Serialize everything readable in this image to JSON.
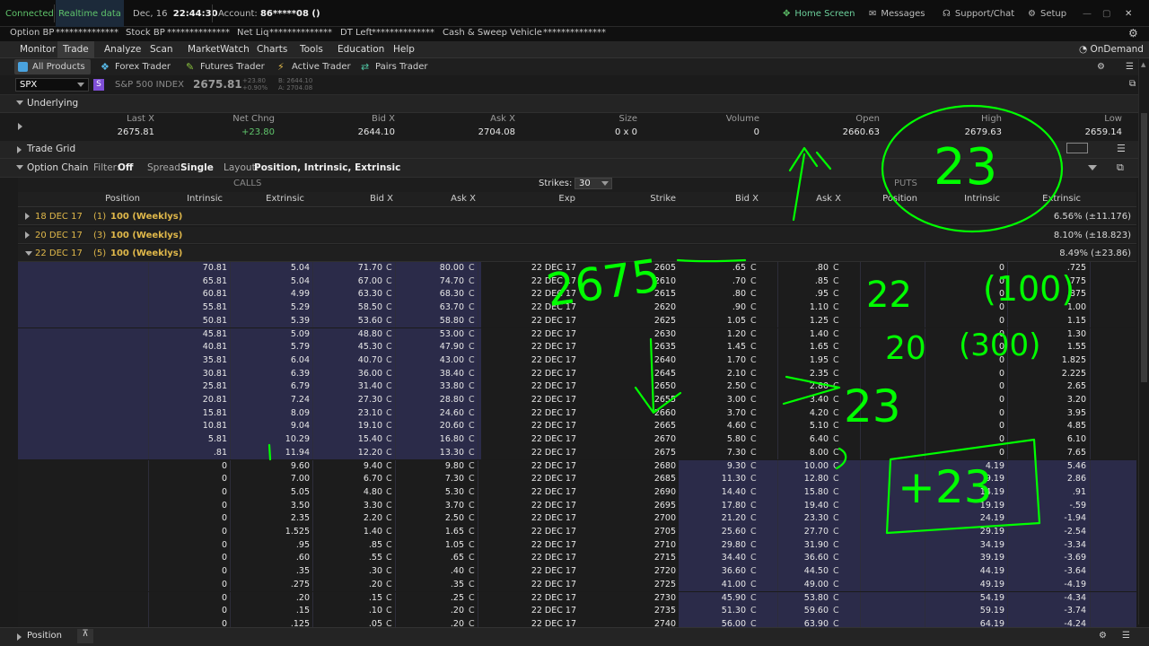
{
  "status": {
    "connected": "Connected",
    "realtime": "Realtime data",
    "date": "Dec, 16",
    "time": "22:44:30",
    "account_label": "Account:",
    "account_value": "86*****08 ()",
    "home_screen": "Home Screen",
    "messages": "Messages",
    "support": "Support/Chat",
    "setup": "Setup"
  },
  "account": {
    "option_bp": "Option BP",
    "option_bp_val": "**************",
    "stock_bp": "Stock BP",
    "stock_bp_val": "**************",
    "net_liq": "Net Liq",
    "net_liq_val": "**************",
    "dt_left": "DT Left",
    "dt_left_val": "**************",
    "cash_sweep": "Cash & Sweep Vehicle",
    "cash_sweep_val": "**************"
  },
  "menu": [
    "Monitor",
    "Trade",
    "Analyze",
    "Scan",
    "MarketWatch",
    "Charts",
    "Tools",
    "Education",
    "Help"
  ],
  "ondemand": "OnDemand",
  "subtabs": [
    "All Products",
    "Forex Trader",
    "Futures Trader",
    "Active Trader",
    "Pairs Trader"
  ],
  "symbol": {
    "ticker": "SPX",
    "badge": "S",
    "name": "S&P 500 INDEX",
    "price": "2675.81",
    "chg": "+23.80",
    "chg_pct": "+0.90%",
    "bid": "B: 2644.10",
    "ask": "A: 2704.08"
  },
  "underlying": {
    "title": "Underlying",
    "headers": [
      "Last X",
      "Net Chng",
      "Bid X",
      "Ask X",
      "Size",
      "Volume",
      "Open",
      "High",
      "Low"
    ],
    "values": [
      "2675.81",
      "+23.80",
      "2644.10",
      "2704.08",
      "0 x 0",
      "0",
      "2660.63",
      "2679.63",
      "2659.14"
    ]
  },
  "trade_grid": "Trade Grid",
  "option_chain": {
    "title": "Option Chain",
    "filter_label": "Filter:",
    "filter_val": "Off",
    "spread_label": "Spread:",
    "spread_val": "Single",
    "layout_label": "Layout:",
    "layout_val": "Position, Intrinsic, Extrinsic",
    "calls": "CALLS",
    "puts": "PUTS",
    "strikes_label": "Strikes:",
    "strikes_val": "30",
    "col_headers": {
      "position": "Position",
      "intrinsic": "Intrinsic",
      "extrinsic": "Extrinsic",
      "bid": "Bid X",
      "ask": "Ask X",
      "exp": "Exp",
      "strike": "Strike",
      "pbid": "Bid X",
      "pask": "Ask X",
      "pposition": "Position",
      "pintrinsic": "Intrinsic",
      "pextrinsic": "Extrinsic"
    }
  },
  "expirations": [
    {
      "date": "18 DEC 17",
      "days": "(1)",
      "mult": "100 (Weeklys)",
      "iv": "6.56% (±11.176)"
    },
    {
      "date": "20 DEC 17",
      "days": "(3)",
      "mult": "100 (Weeklys)",
      "iv": "8.10% (±18.823)"
    },
    {
      "date": "22 DEC 17",
      "days": "(5)",
      "mult": "100 (Weeklys)",
      "iv": "8.49% (±23.86)"
    }
  ],
  "chain_rows": [
    {
      "ci": "70.81",
      "ce": "5.04",
      "cb": "71.70",
      "ca": "80.00",
      "exp": "22 DEC 17",
      "k": "2605",
      "pb": ".65",
      "pa": ".80",
      "pi": "0",
      "pe": ".725",
      "itm": true
    },
    {
      "ci": "65.81",
      "ce": "5.04",
      "cb": "67.00",
      "ca": "74.70",
      "exp": "22 DEC 17",
      "k": "2610",
      "pb": ".70",
      "pa": ".85",
      "pi": "0",
      "pe": ".775",
      "itm": true
    },
    {
      "ci": "60.81",
      "ce": "4.99",
      "cb": "63.30",
      "ca": "68.30",
      "exp": "22 DEC 17",
      "k": "2615",
      "pb": ".80",
      "pa": ".95",
      "pi": "0",
      "pe": ".875",
      "itm": true
    },
    {
      "ci": "55.81",
      "ce": "5.29",
      "cb": "58.50",
      "ca": "63.70",
      "exp": "22 DEC 17",
      "k": "2620",
      "pb": ".90",
      "pa": "1.10",
      "pi": "0",
      "pe": "1.00",
      "itm": true
    },
    {
      "ci": "50.81",
      "ce": "5.39",
      "cb": "53.60",
      "ca": "58.80",
      "exp": "22 DEC 17",
      "k": "2625",
      "pb": "1.05",
      "pa": "1.25",
      "pi": "0",
      "pe": "1.15",
      "itm": true
    },
    {
      "ci": "45.81",
      "ce": "5.09",
      "cb": "48.80",
      "ca": "53.00",
      "exp": "22 DEC 17",
      "k": "2630",
      "pb": "1.20",
      "pa": "1.40",
      "pi": "0",
      "pe": "1.30",
      "itm": true
    },
    {
      "ci": "40.81",
      "ce": "5.79",
      "cb": "45.30",
      "ca": "47.90",
      "exp": "22 DEC 17",
      "k": "2635",
      "pb": "1.45",
      "pa": "1.65",
      "pi": "0",
      "pe": "1.55",
      "itm": true
    },
    {
      "ci": "35.81",
      "ce": "6.04",
      "cb": "40.70",
      "ca": "43.00",
      "exp": "22 DEC 17",
      "k": "2640",
      "pb": "1.70",
      "pa": "1.95",
      "pi": "0",
      "pe": "1.825",
      "itm": true
    },
    {
      "ci": "30.81",
      "ce": "6.39",
      "cb": "36.00",
      "ca": "38.40",
      "exp": "22 DEC 17",
      "k": "2645",
      "pb": "2.10",
      "pa": "2.35",
      "pi": "0",
      "pe": "2.225",
      "itm": true
    },
    {
      "ci": "25.81",
      "ce": "6.79",
      "cb": "31.40",
      "ca": "33.80",
      "exp": "22 DEC 17",
      "k": "2650",
      "pb": "2.50",
      "pa": "2.80",
      "pi": "0",
      "pe": "2.65",
      "itm": true
    },
    {
      "ci": "20.81",
      "ce": "7.24",
      "cb": "27.30",
      "ca": "28.80",
      "exp": "22 DEC 17",
      "k": "2655",
      "pb": "3.00",
      "pa": "3.40",
      "pi": "0",
      "pe": "3.20",
      "itm": true
    },
    {
      "ci": "15.81",
      "ce": "8.09",
      "cb": "23.10",
      "ca": "24.60",
      "exp": "22 DEC 17",
      "k": "2660",
      "pb": "3.70",
      "pa": "4.20",
      "pi": "0",
      "pe": "3.95",
      "itm": true
    },
    {
      "ci": "10.81",
      "ce": "9.04",
      "cb": "19.10",
      "ca": "20.60",
      "exp": "22 DEC 17",
      "k": "2665",
      "pb": "4.60",
      "pa": "5.10",
      "pi": "0",
      "pe": "4.85",
      "itm": true
    },
    {
      "ci": "5.81",
      "ce": "10.29",
      "cb": "15.40",
      "ca": "16.80",
      "exp": "22 DEC 17",
      "k": "2670",
      "pb": "5.80",
      "pa": "6.40",
      "pi": "0",
      "pe": "6.10",
      "itm": true
    },
    {
      "ci": ".81",
      "ce": "11.94",
      "cb": "12.20",
      "ca": "13.30",
      "exp": "22 DEC 17",
      "k": "2675",
      "pb": "7.30",
      "pa": "8.00",
      "pi": "0",
      "pe": "7.65",
      "itm": true
    },
    {
      "ci": "0",
      "ce": "9.60",
      "cb": "9.40",
      "ca": "9.80",
      "exp": "22 DEC 17",
      "k": "2680",
      "pb": "9.30",
      "pa": "10.00",
      "pi": "4.19",
      "pe": "5.46",
      "itm": false
    },
    {
      "ci": "0",
      "ce": "7.00",
      "cb": "6.70",
      "ca": "7.30",
      "exp": "22 DEC 17",
      "k": "2685",
      "pb": "11.30",
      "pa": "12.80",
      "pi": "9.19",
      "pe": "2.86",
      "itm": false
    },
    {
      "ci": "0",
      "ce": "5.05",
      "cb": "4.80",
      "ca": "5.30",
      "exp": "22 DEC 17",
      "k": "2690",
      "pb": "14.40",
      "pa": "15.80",
      "pi": "14.19",
      "pe": ".91",
      "itm": false
    },
    {
      "ci": "0",
      "ce": "3.50",
      "cb": "3.30",
      "ca": "3.70",
      "exp": "22 DEC 17",
      "k": "2695",
      "pb": "17.80",
      "pa": "19.40",
      "pi": "19.19",
      "pe": "-.59",
      "itm": false
    },
    {
      "ci": "0",
      "ce": "2.35",
      "cb": "2.20",
      "ca": "2.50",
      "exp": "22 DEC 17",
      "k": "2700",
      "pb": "21.20",
      "pa": "23.30",
      "pi": "24.19",
      "pe": "-1.94",
      "itm": false
    },
    {
      "ci": "0",
      "ce": "1.525",
      "cb": "1.40",
      "ca": "1.65",
      "exp": "22 DEC 17",
      "k": "2705",
      "pb": "25.60",
      "pa": "27.70",
      "pi": "29.19",
      "pe": "-2.54",
      "itm": false
    },
    {
      "ci": "0",
      "ce": ".95",
      "cb": ".85",
      "ca": "1.05",
      "exp": "22 DEC 17",
      "k": "2710",
      "pb": "29.80",
      "pa": "31.90",
      "pi": "34.19",
      "pe": "-3.34",
      "itm": false
    },
    {
      "ci": "0",
      "ce": ".60",
      "cb": ".55",
      "ca": ".65",
      "exp": "22 DEC 17",
      "k": "2715",
      "pb": "34.40",
      "pa": "36.60",
      "pi": "39.19",
      "pe": "-3.69",
      "itm": false
    },
    {
      "ci": "0",
      "ce": ".35",
      "cb": ".30",
      "ca": ".40",
      "exp": "22 DEC 17",
      "k": "2720",
      "pb": "36.60",
      "pa": "44.50",
      "pi": "44.19",
      "pe": "-3.64",
      "itm": false
    },
    {
      "ci": "0",
      "ce": ".275",
      "cb": ".20",
      "ca": ".35",
      "exp": "22 DEC 17",
      "k": "2725",
      "pb": "41.00",
      "pa": "49.00",
      "pi": "49.19",
      "pe": "-4.19",
      "itm": false
    },
    {
      "ci": "0",
      "ce": ".20",
      "cb": ".15",
      "ca": ".25",
      "exp": "22 DEC 17",
      "k": "2730",
      "pb": "45.90",
      "pa": "53.80",
      "pi": "54.19",
      "pe": "-4.34",
      "itm": false
    },
    {
      "ci": "0",
      "ce": ".15",
      "cb": ".10",
      "ca": ".20",
      "exp": "22 DEC 17",
      "k": "2735",
      "pb": "51.30",
      "pa": "59.60",
      "pi": "59.19",
      "pe": "-3.74",
      "itm": false
    },
    {
      "ci": "0",
      "ce": ".125",
      "cb": ".05",
      "ca": ".20",
      "exp": "22 DEC 17",
      "k": "2740",
      "pb": "56.00",
      "pa": "63.90",
      "pi": "64.19",
      "pe": "-4.24",
      "itm": false
    }
  ],
  "exchange_code": "C",
  "bottom": {
    "position": "Position"
  },
  "annotations": {
    "circle_23": "23",
    "num_2675": "2675",
    "num_22": "22",
    "num_100": "(100)",
    "num_20": "20",
    "num_300": "(300)",
    "arrow_23": "23",
    "box_23": "+23",
    "ink_color": "#00ff00"
  },
  "colors": {
    "itm_bg": "#2b2b49",
    "accent_green": "#5fc46b",
    "gold": "#e0b84a"
  }
}
